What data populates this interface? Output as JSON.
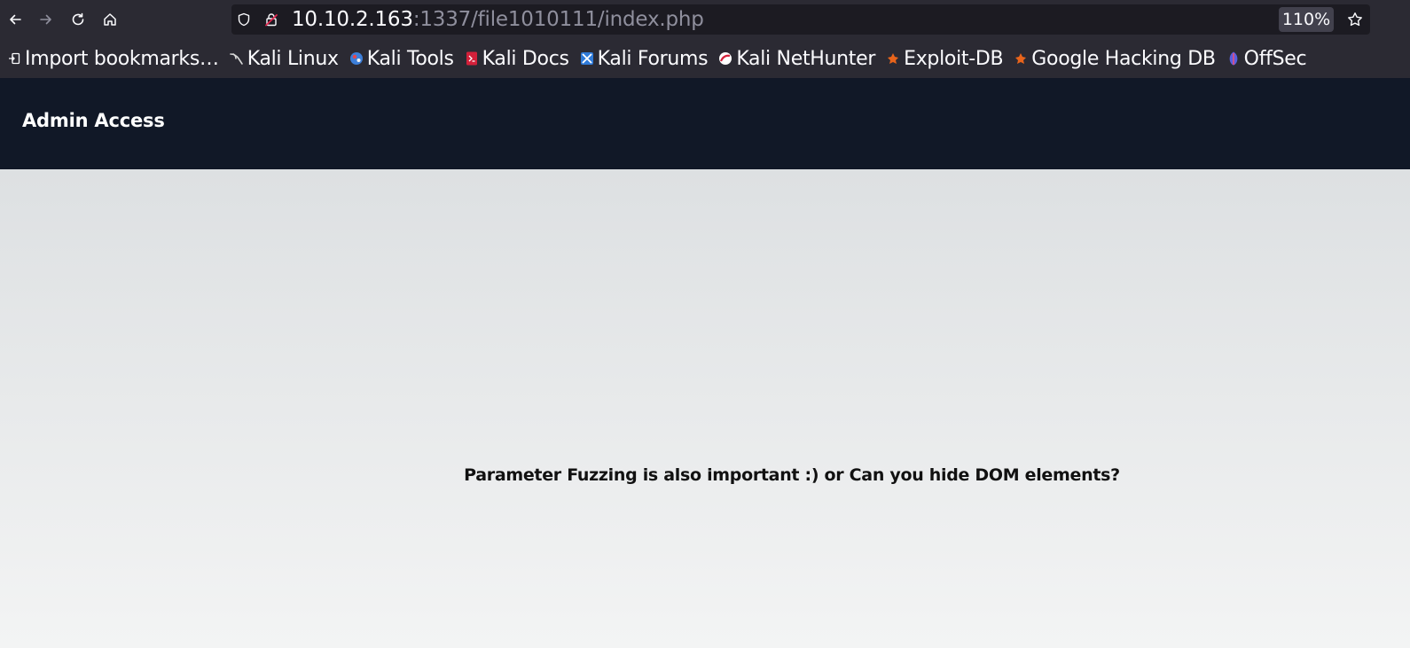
{
  "browser": {
    "url_host": "10.10.2.163",
    "url_path": ":1337/file1010111/index.php",
    "zoom": "110%"
  },
  "bookmarks": [
    {
      "label": "Import bookmarks…",
      "icon": "import-icon"
    },
    {
      "label": "Kali Linux",
      "icon": "kali-linux-icon"
    },
    {
      "label": "Kali Tools",
      "icon": "kali-tools-icon"
    },
    {
      "label": "Kali Docs",
      "icon": "kali-docs-icon"
    },
    {
      "label": "Kali Forums",
      "icon": "kali-forums-icon"
    },
    {
      "label": "Kali NetHunter",
      "icon": "kali-nethunter-icon"
    },
    {
      "label": "Exploit-DB",
      "icon": "exploit-db-icon"
    },
    {
      "label": "Google Hacking DB",
      "icon": "ghdb-icon"
    },
    {
      "label": "OffSec",
      "icon": "offsec-icon"
    }
  ],
  "page": {
    "title": "Admin Access",
    "message": "Parameter Fuzzing is also important :) or Can you hide DOM elements?"
  },
  "colors": {
    "toolbar_bg": "#2b2a33",
    "urlbar_bg": "#1c1b22",
    "header_bg": "#111827",
    "text_primary": "#fbfbfe"
  }
}
